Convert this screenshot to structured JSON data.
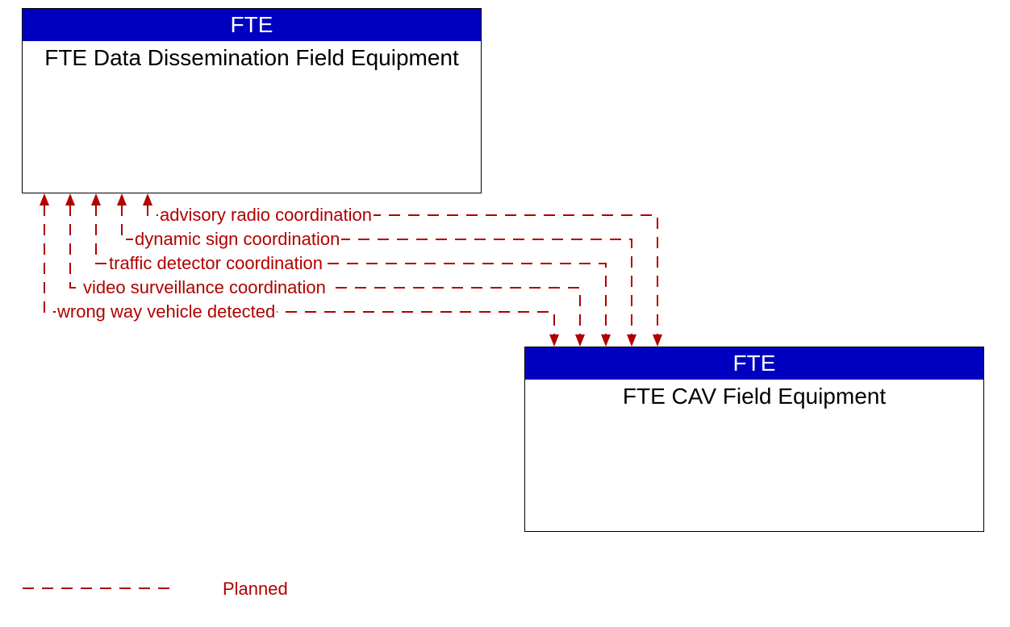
{
  "nodes": {
    "top": {
      "header": "FTE",
      "body": "FTE Data Dissemination Field Equipment"
    },
    "bottom": {
      "header": "FTE",
      "body": "FTE CAV Field Equipment"
    }
  },
  "flows": {
    "f1": "advisory radio coordination",
    "f2": "dynamic sign coordination",
    "f3": "traffic detector coordination",
    "f4": "video surveillance coordination",
    "f5": "wrong way vehicle detected"
  },
  "legend": {
    "planned": "Planned"
  },
  "colors": {
    "node_header_bg": "#0000c0",
    "flow": "#b00000"
  }
}
